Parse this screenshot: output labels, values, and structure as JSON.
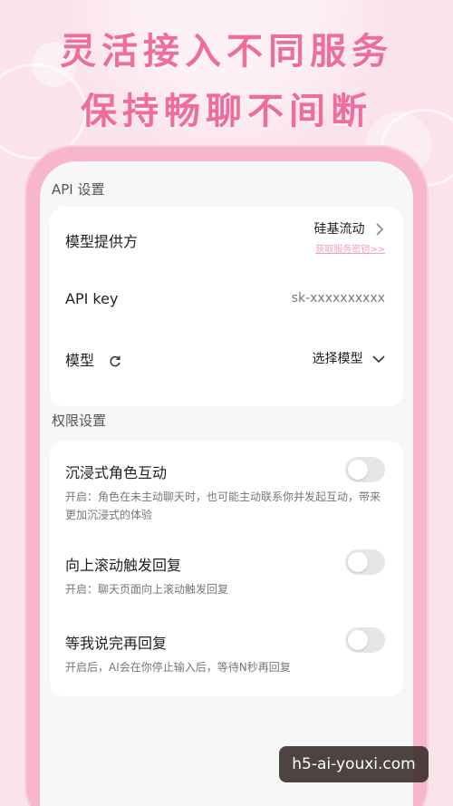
{
  "hero": {
    "line1": "灵活接入不同服务",
    "line2": "保持畅聊不间断"
  },
  "api_section": {
    "title": "API 设置",
    "provider": {
      "label": "模型提供方",
      "value": "硅基流动",
      "link": "获取服务密钥>>"
    },
    "api_key": {
      "label": "API key",
      "value": "sk-xxxxxxxxxx"
    },
    "model": {
      "label": "模型",
      "value": "选择模型"
    }
  },
  "permission_section": {
    "title": "权限设置",
    "items": [
      {
        "label": "沉浸式角色互动",
        "desc": "开启：角色在未主动聊天时，也可能主动联系你并发起互动，带来更加沉浸式的体验",
        "enabled": false
      },
      {
        "label": "向上滚动触发回复",
        "desc": "开启：聊天页面向上滚动触发回复",
        "enabled": false
      },
      {
        "label": "等我说完再回复",
        "desc": "开启后，AI会在你停止输入后，等待N秒再回复",
        "enabled": false
      }
    ]
  },
  "watermark": "h5-ai-youxi.com",
  "colors": {
    "hero_text": "#ee6d9c",
    "phone_frame": "#f7b6cb",
    "link": "#f2a0be",
    "toggle_off": "#e6e6e6"
  },
  "icons": {
    "provider_chevron": "chevron-right-icon",
    "model_refresh": "refresh-icon",
    "model_dropdown": "chevron-down-icon"
  }
}
